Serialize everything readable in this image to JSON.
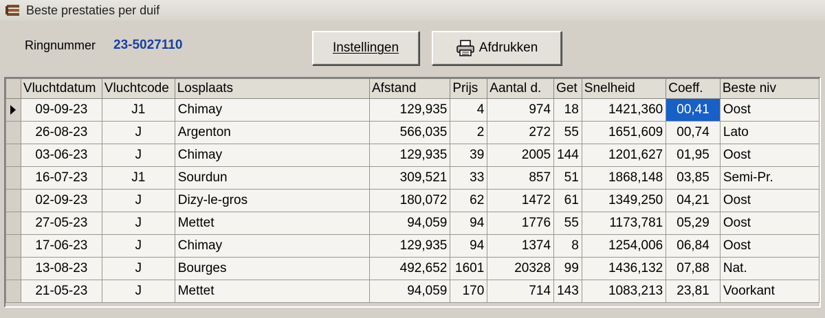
{
  "window": {
    "title": "Beste prestaties per duif"
  },
  "ring": {
    "label": "Ringnummer",
    "value": "23-5027110"
  },
  "buttons": {
    "settings": "Instellingen",
    "print": "Afdrukken"
  },
  "table": {
    "columns": [
      "Vluchtdatum",
      "Vluchtcode",
      "Losplaats",
      "Afstand",
      "Prijs",
      "Aantal d.",
      "Get",
      "Snelheid",
      "Coeff.",
      "Beste niv"
    ],
    "rows": [
      [
        "09-09-23",
        "J1",
        "Chimay",
        "129,935",
        "4",
        "974",
        "18",
        "1421,360",
        "00,41",
        "Oost"
      ],
      [
        "26-08-23",
        "J",
        "Argenton",
        "566,035",
        "2",
        "272",
        "55",
        "1651,609",
        "00,74",
        "Lato"
      ],
      [
        "03-06-23",
        "J",
        "Chimay",
        "129,935",
        "39",
        "2005",
        "144",
        "1201,627",
        "01,95",
        "Oost"
      ],
      [
        "16-07-23",
        "J1",
        "Sourdun",
        "309,521",
        "33",
        "857",
        "51",
        "1868,148",
        "03,85",
        "Semi-Pr."
      ],
      [
        "02-09-23",
        "J",
        "Dizy-le-gros",
        "180,072",
        "62",
        "1472",
        "61",
        "1349,250",
        "04,21",
        "Oost"
      ],
      [
        "27-05-23",
        "J",
        "Mettet",
        "94,059",
        "94",
        "1776",
        "55",
        "1173,781",
        "05,29",
        "Oost"
      ],
      [
        "17-06-23",
        "J",
        "Chimay",
        "129,935",
        "94",
        "1374",
        "8",
        "1254,006",
        "06,84",
        "Oost"
      ],
      [
        "13-08-23",
        "J",
        "Bourges",
        "492,652",
        "1601",
        "20328",
        "99",
        "1436,132",
        "07,88",
        "Nat."
      ],
      [
        "21-05-23",
        "J",
        "Mettet",
        "94,059",
        "170",
        "714",
        "143",
        "1083,213",
        "23,81",
        "Voorkant"
      ]
    ],
    "selected_row": 0,
    "selected_column": "Coeff."
  },
  "colors": {
    "background": "#d4d0c8",
    "ring_value": "#1b3fa0",
    "selection": "#1660c8"
  }
}
